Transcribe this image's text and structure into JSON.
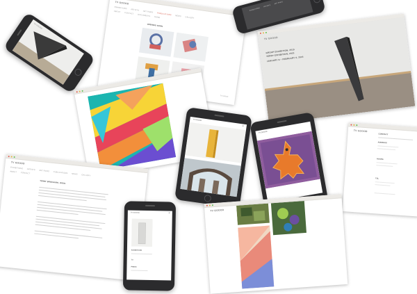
{
  "site": {
    "logo_text": "TV GOOOD",
    "nav_items": [
      "EXHIBITIONS",
      "ARTISTS",
      "ART FAIRS",
      "PUBLICATIONS",
      "NEWS",
      "GALLERY",
      "ABOUT",
      "CONTACT",
      "DOCUMENTS",
      "HOME"
    ]
  },
  "cards": {
    "sculpture_window": {
      "title": "OPENING SOON"
    },
    "exhibition_hero": {
      "headline": [
        "GROUP EXHIBITION, 2015",
        "TERRY EXHIBITION, 2015"
      ],
      "dates": "JANUARY 9 – FEBRUARY 6, 2016"
    },
    "text_window": {
      "headline": "TERRY BROCHURE, OPEN"
    },
    "contact_window": {
      "heading_contact": "CONTACT",
      "heading_address": "ADDRESS",
      "heading_hours": "HOURS",
      "heading_phone": "TEL"
    },
    "phone_bottom": {
      "section1": "EXHIBITIONS",
      "section2": "TV",
      "section3": "PRESS"
    }
  },
  "colors": {
    "accent": "#d85c4c",
    "phone_body": "#2b2b2d"
  }
}
